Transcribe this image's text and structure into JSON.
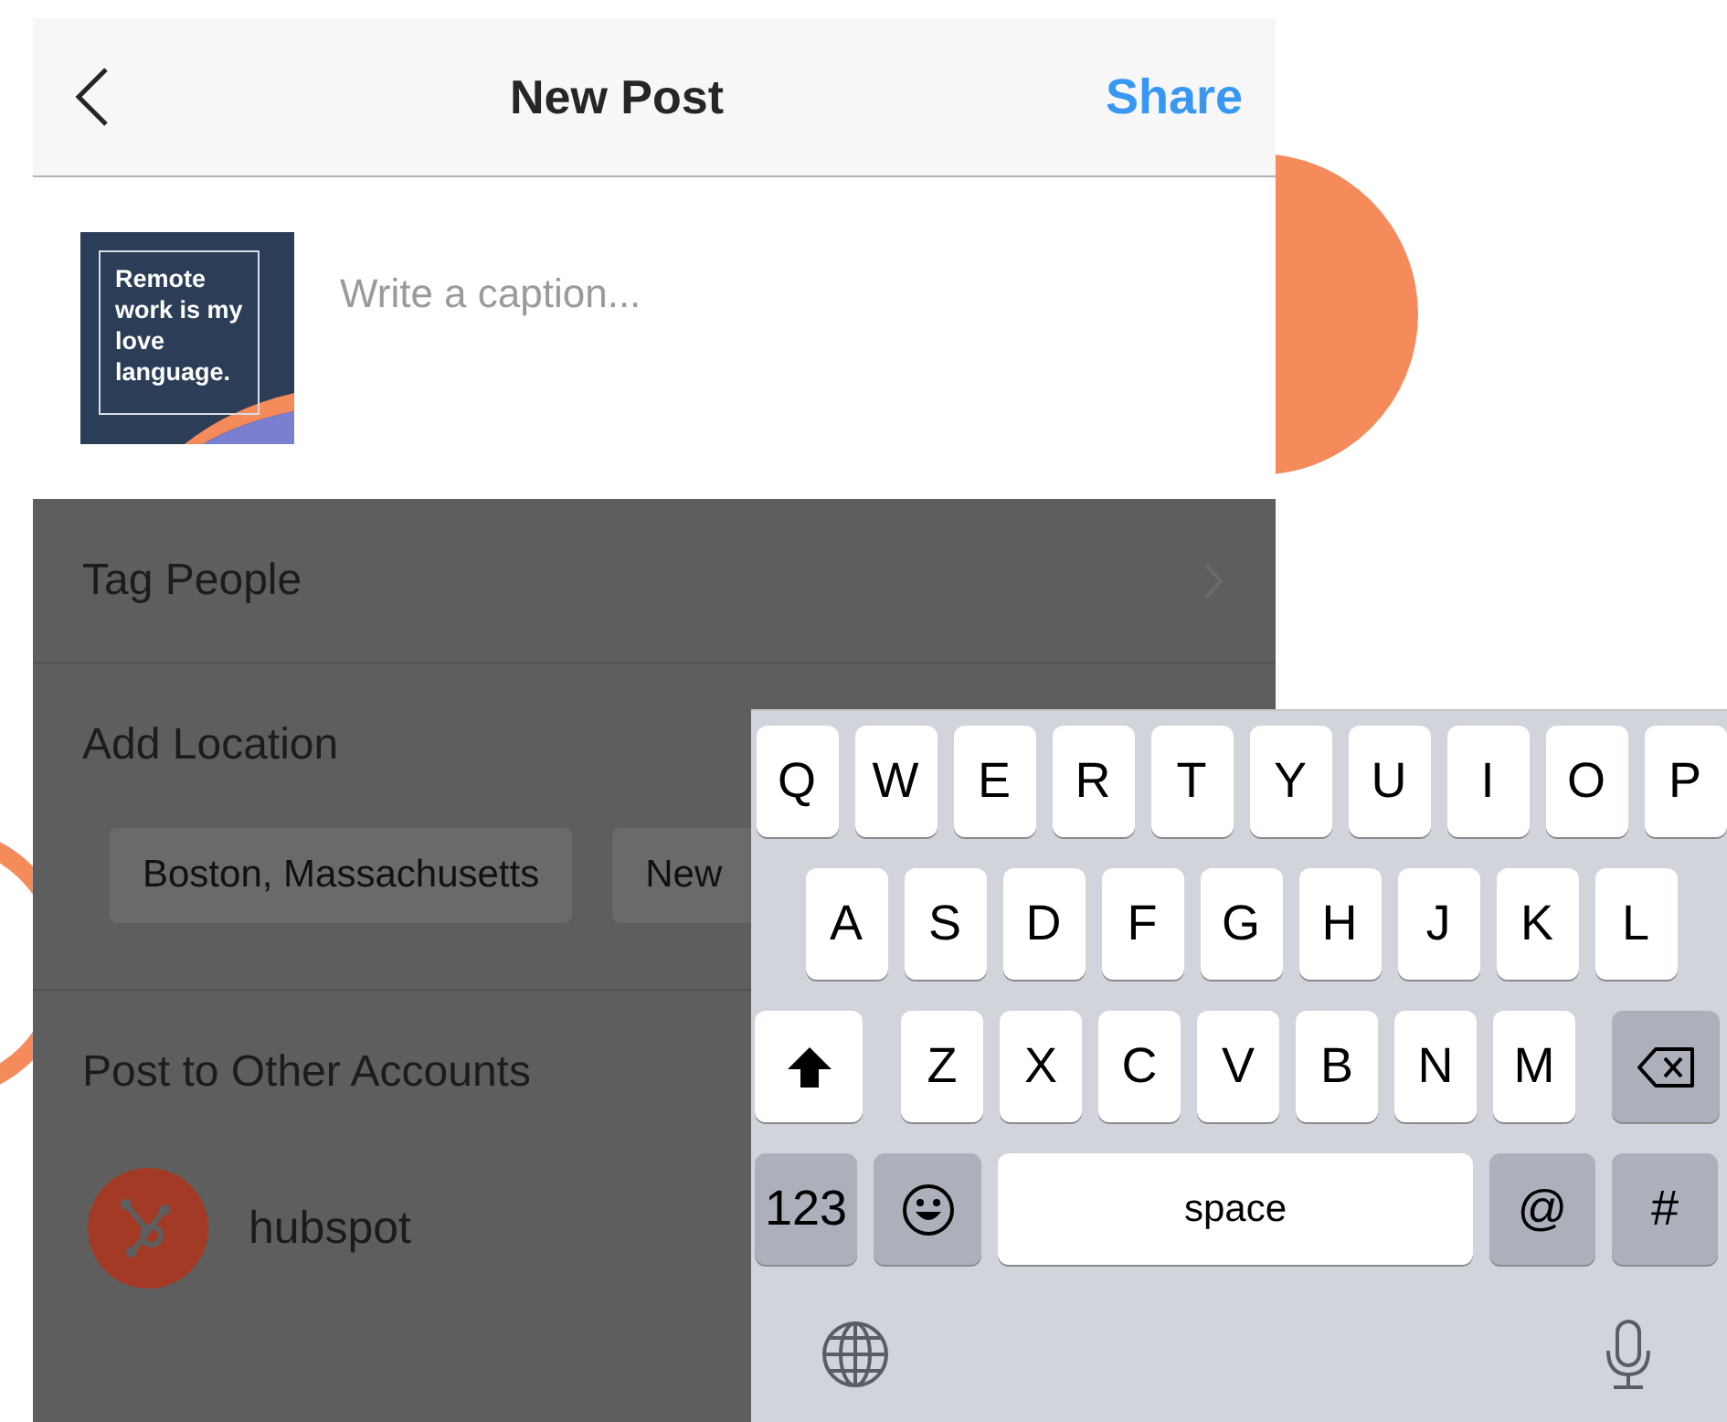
{
  "header": {
    "title": "New Post",
    "action": "Share"
  },
  "caption": {
    "thumbnail_text": "Remote work is my love language.",
    "placeholder": "Write a caption..."
  },
  "options": [
    {
      "label": "Tag People",
      "kind": "link"
    },
    {
      "label": "Add Location",
      "kind": "location",
      "suggestions": [
        "Boston, Massachusetts",
        "New"
      ]
    },
    {
      "label": "Post to Other Accounts",
      "kind": "accounts",
      "accounts": [
        {
          "name": "hubspot"
        }
      ]
    }
  ],
  "keyboard": {
    "letter_rows": [
      [
        "Q",
        "W",
        "E",
        "R",
        "T",
        "Y",
        "U",
        "I",
        "O",
        "P"
      ],
      [
        "A",
        "S",
        "D",
        "F",
        "G",
        "H",
        "J",
        "K",
        "L"
      ],
      [
        "Z",
        "X",
        "C",
        "V",
        "B",
        "N",
        "M"
      ]
    ],
    "function_keys": [
      {
        "kind": "mode",
        "label": "123"
      },
      {
        "kind": "emoji"
      },
      {
        "kind": "space",
        "label": "space"
      },
      {
        "kind": "symbol",
        "label": "@"
      },
      {
        "kind": "symbol",
        "label": "#"
      }
    ],
    "system_keys": [
      {
        "kind": "globe"
      },
      {
        "kind": "mic"
      }
    ]
  }
}
